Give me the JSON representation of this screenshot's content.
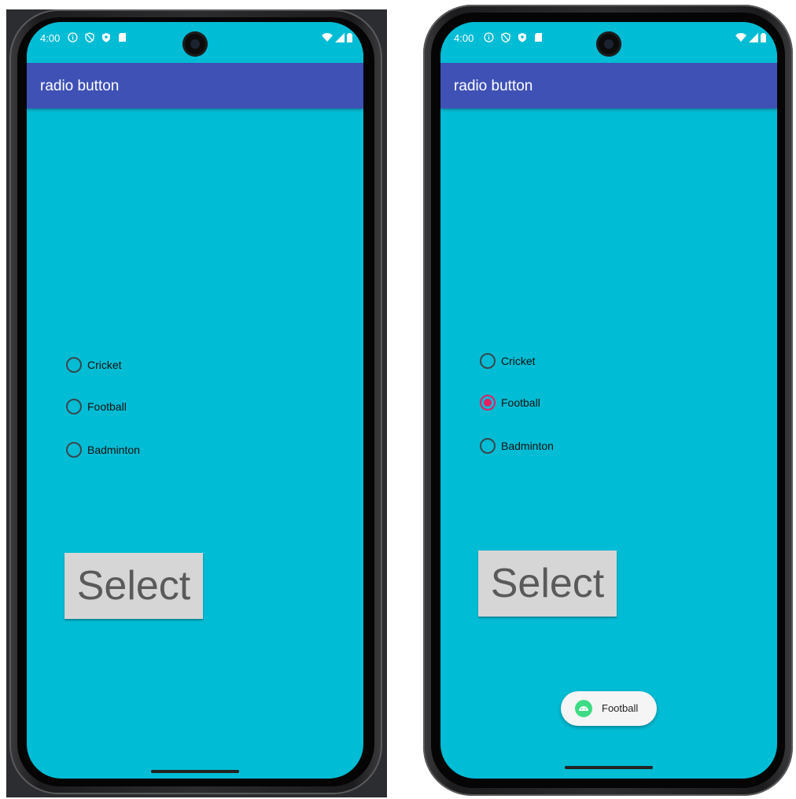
{
  "screens": [
    {
      "status_time": "4:00",
      "app_title": "radio button",
      "radios": [
        {
          "label": "Cricket",
          "checked": false
        },
        {
          "label": "Football",
          "checked": false
        },
        {
          "label": "Badminton",
          "checked": false
        }
      ],
      "select_label": "Select"
    },
    {
      "status_time": "4:00",
      "app_title": "radio button",
      "radios": [
        {
          "label": "Cricket",
          "checked": false
        },
        {
          "label": "Football",
          "checked": true
        },
        {
          "label": "Badminton",
          "checked": false
        }
      ],
      "select_label": "Select",
      "toast": {
        "text": "Football",
        "icon": "android-icon"
      }
    }
  ],
  "colors": {
    "screen_bg": "#00bcd4",
    "appbar": "#3f51b5",
    "radio_checked": "#e91e63",
    "button_bg": "#d6d6d6"
  }
}
